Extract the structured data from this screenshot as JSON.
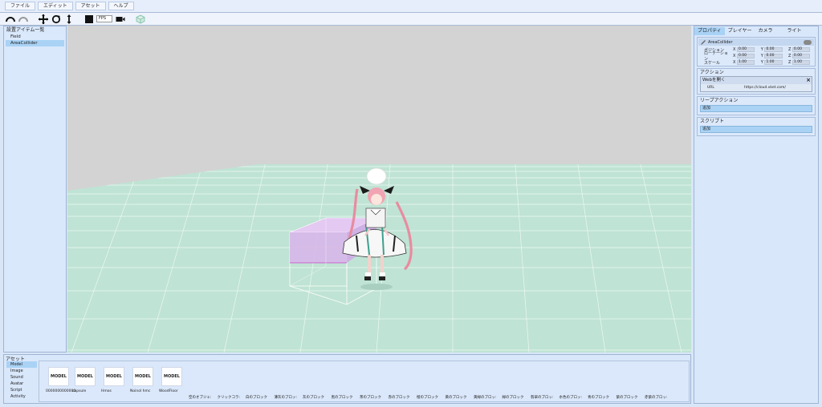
{
  "menu": [
    "ファイル",
    "エディット",
    "アセット",
    "ヘルプ"
  ],
  "toolbar": {
    "icons": [
      "undo-icon",
      "redo-icon",
      "move-icon",
      "rotate-icon",
      "scale-icon",
      "stop-icon",
      "camera-icon",
      "cube-icon"
    ],
    "fps_value": "FPS"
  },
  "left_panel": {
    "title": "設置アイテム一覧",
    "items": [
      {
        "label": "Field",
        "selected": false
      },
      {
        "label": "AreaCollider",
        "selected": true
      }
    ]
  },
  "right_panel": {
    "tabs": [
      {
        "label": "プロパティ",
        "active": true
      },
      {
        "label": "プレイヤー",
        "active": false
      },
      {
        "label": "カメラ",
        "active": false
      },
      {
        "label": "ライト",
        "active": false
      }
    ],
    "object_name": "AreaCollider",
    "props": [
      {
        "label": "ポジション",
        "x": "0.00",
        "y": "0.00",
        "z": "0.00"
      },
      {
        "label": "ローテーション",
        "x": "0.00",
        "y": "0.00",
        "z": "0.00"
      },
      {
        "label": "スケール",
        "x": "1.00",
        "y": "1.00",
        "z": "1.00"
      }
    ],
    "action_title": "アクション",
    "action_card": {
      "title": "Webを開く",
      "url_label": "URL",
      "url_value": "https://cloud.vket.com/"
    },
    "loop_title": "リープアクション",
    "loop_add": "追加",
    "script_title": "スクリプト",
    "script_add": "追加"
  },
  "asset_panel": {
    "title": "アセット",
    "categories": [
      {
        "label": "Model",
        "selected": true
      },
      {
        "label": "Image",
        "selected": false
      },
      {
        "label": "Sound",
        "selected": false
      },
      {
        "label": "Avatar",
        "selected": false
      },
      {
        "label": "Script",
        "selected": false
      },
      {
        "label": "Activity",
        "selected": false
      }
    ],
    "models": [
      {
        "thumb": "MODEL",
        "label": "0000000000000"
      },
      {
        "thumb": "MODEL",
        "label": "capsule"
      },
      {
        "thumb": "MODEL",
        "label": "Hmos"
      },
      {
        "thumb": "MODEL",
        "label": "Noinol hmc"
      },
      {
        "thumb": "MODEL",
        "label": "WoodFloor"
      }
    ],
    "blocks": [
      "空のオブジェ:",
      "クリックコラ:",
      "白のブロック",
      "薄灰のブロッ:",
      "灰のブロック",
      "黒のブロック",
      "茶のブロック",
      "赤のブロック",
      "橙のブロック",
      "黄のブロック",
      "黄緑のブロッ:",
      "緑のブロック",
      "翡翠のブロッ:",
      "水色のブロッ:",
      "青のブロック",
      "紫のブロック",
      "赤紫のブロッ:"
    ]
  },
  "colors": {
    "accent_selection": "#a9d2f5",
    "panel_bg": "#d9e7fb",
    "floor": "#bfe3d4",
    "sky": "#d3d3d3",
    "collider": "#d8b4ea"
  }
}
